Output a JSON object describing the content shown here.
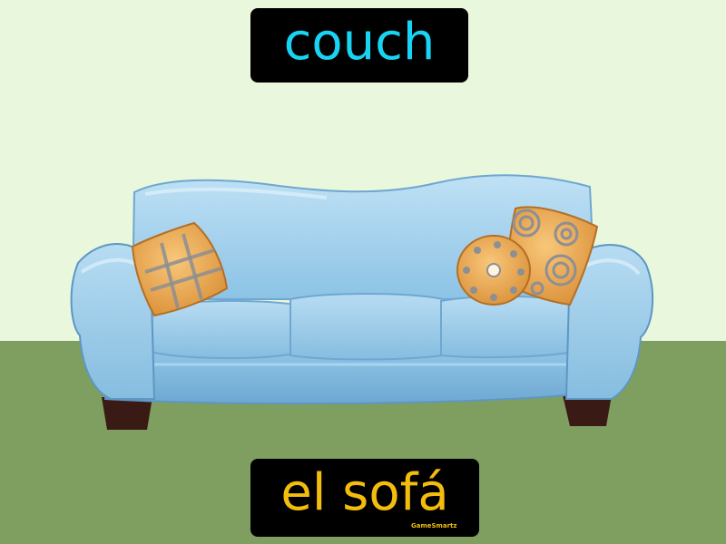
{
  "labels": {
    "english": "couch",
    "spanish": "el sofá"
  },
  "brand": "GameSmartz",
  "colors": {
    "wall": "#e9f7dc",
    "floor": "#7f9f60",
    "english_text": "#19d3f2",
    "spanish_text": "#f3bd0d",
    "label_background": "#000000",
    "brand_text": "#f3bd0d",
    "sofa_light": "#a9d4ee",
    "sofa_mid": "#86bde0",
    "sofa_dark": "#5d97c3",
    "pillow": "#f0ad55",
    "pillow_pattern": "#8d8f93"
  },
  "icons": [
    "couch-illustration",
    "plaid-pillow-icon",
    "round-pillow-icon",
    "square-pillow-icon"
  ]
}
